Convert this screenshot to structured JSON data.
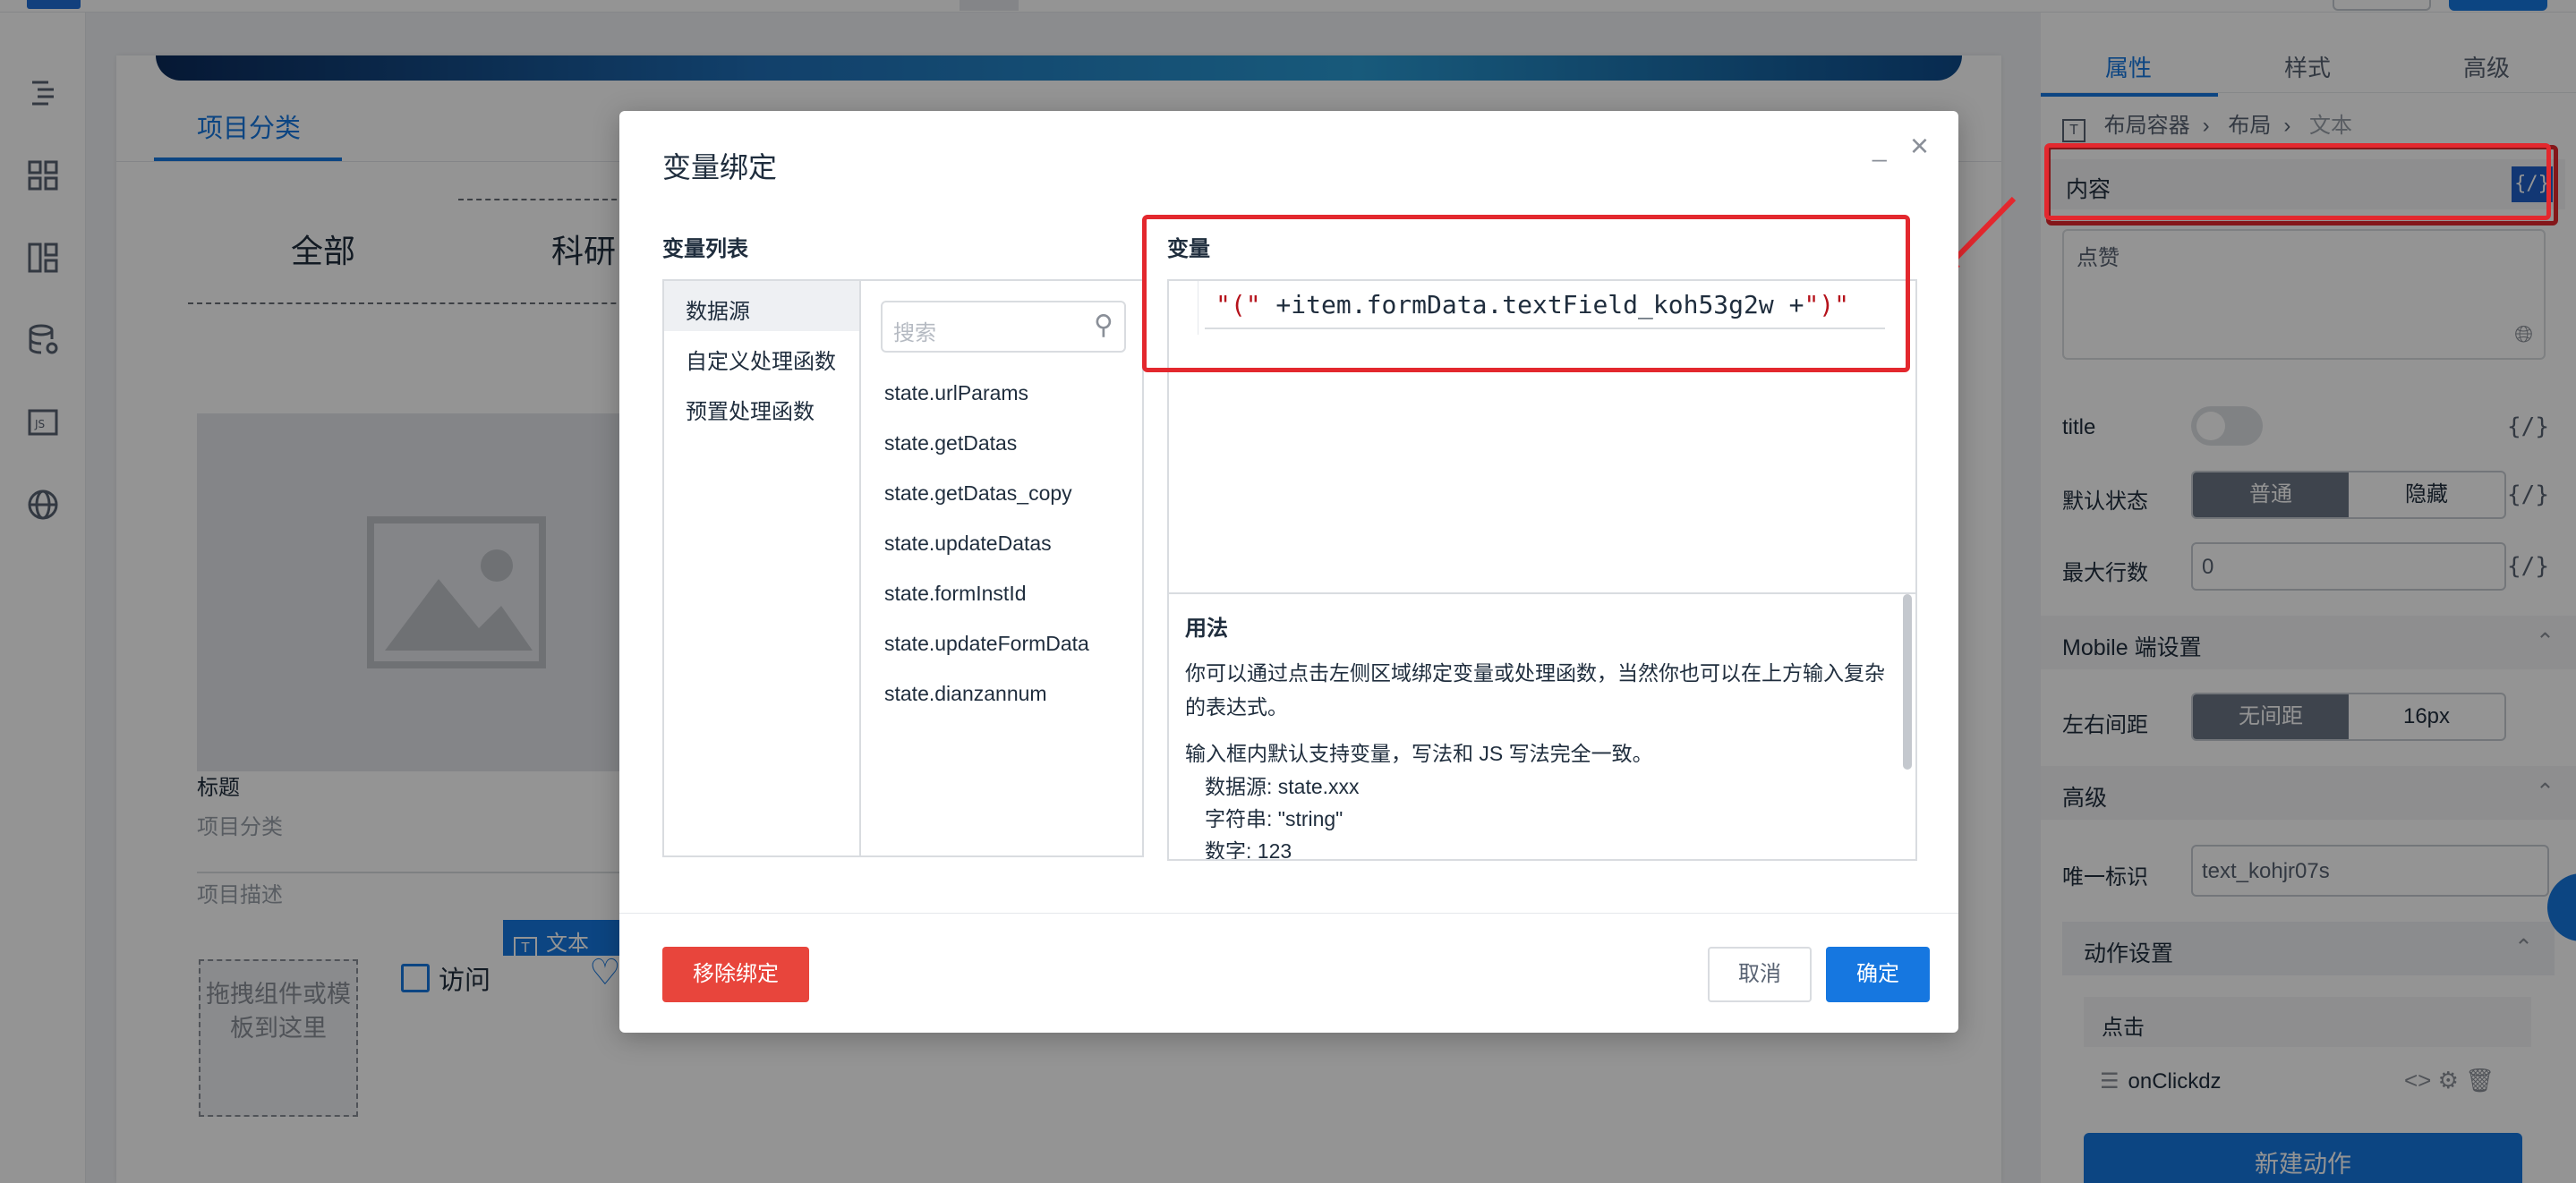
{
  "background": {
    "category_tab": "项目分类",
    "filters": [
      "全部",
      "科研"
    ],
    "card": {
      "title": "标题",
      "subtitle": "项目分类",
      "description": "项目描述",
      "text_tag": "文本",
      "drop_zone": "拖拽组件或模板到这里",
      "visit": "访问"
    }
  },
  "right_panel": {
    "tabs": [
      "属性",
      "样式",
      "高级"
    ],
    "breadcrumb": [
      "布局容器",
      "布局",
      "文本"
    ],
    "content_label": "内容",
    "content_value": "点赞",
    "title_label": "title",
    "default_state_label": "默认状态",
    "default_state_options": [
      "普通",
      "隐藏"
    ],
    "max_lines_label": "最大行数",
    "max_lines_value": "0",
    "mobile_section": "Mobile 端设置",
    "padding_label": "左右间距",
    "padding_options": [
      "无间距",
      "16px"
    ],
    "advanced_section": "高级",
    "uid_label": "唯一标识",
    "uid_value": "text_kohjr07s",
    "action_section": "动作设置",
    "click_label": "点击",
    "handler_name": "onClickdz",
    "new_action": "新建动作",
    "bind_icon": "{/}"
  },
  "modal": {
    "title": "变量绑定",
    "var_list_title": "变量列表",
    "var_title": "变量",
    "categories": [
      "数据源",
      "自定义处理函数",
      "预置处理函数"
    ],
    "search_placeholder": "搜索",
    "states": [
      "state.urlParams",
      "state.getDatas",
      "state.getDatas_copy",
      "state.updateDatas",
      "state.formInstId",
      "state.updateFormData",
      "state.dianzannum"
    ],
    "expression": {
      "part1": "\"(\"",
      "part2": " +item.formData.textField_koh53g2w +",
      "part3": "\")\""
    },
    "usage": {
      "title": "用法",
      "line1": "你可以通过点击左侧区域绑定变量或处理函数，当然你也可以在上方输入复杂的表达式。",
      "line2": "输入框内默认支持变量，写法和 JS 写法完全一致。",
      "examples": [
        "数据源: state.xxx",
        "字符串: \"string\"",
        "数字: 123"
      ]
    },
    "buttons": {
      "unbind": "移除绑定",
      "cancel": "取消",
      "ok": "确定"
    }
  },
  "colors": {
    "accent": "#1677e0",
    "danger": "#e8453c",
    "annotation": "#e3282e"
  }
}
